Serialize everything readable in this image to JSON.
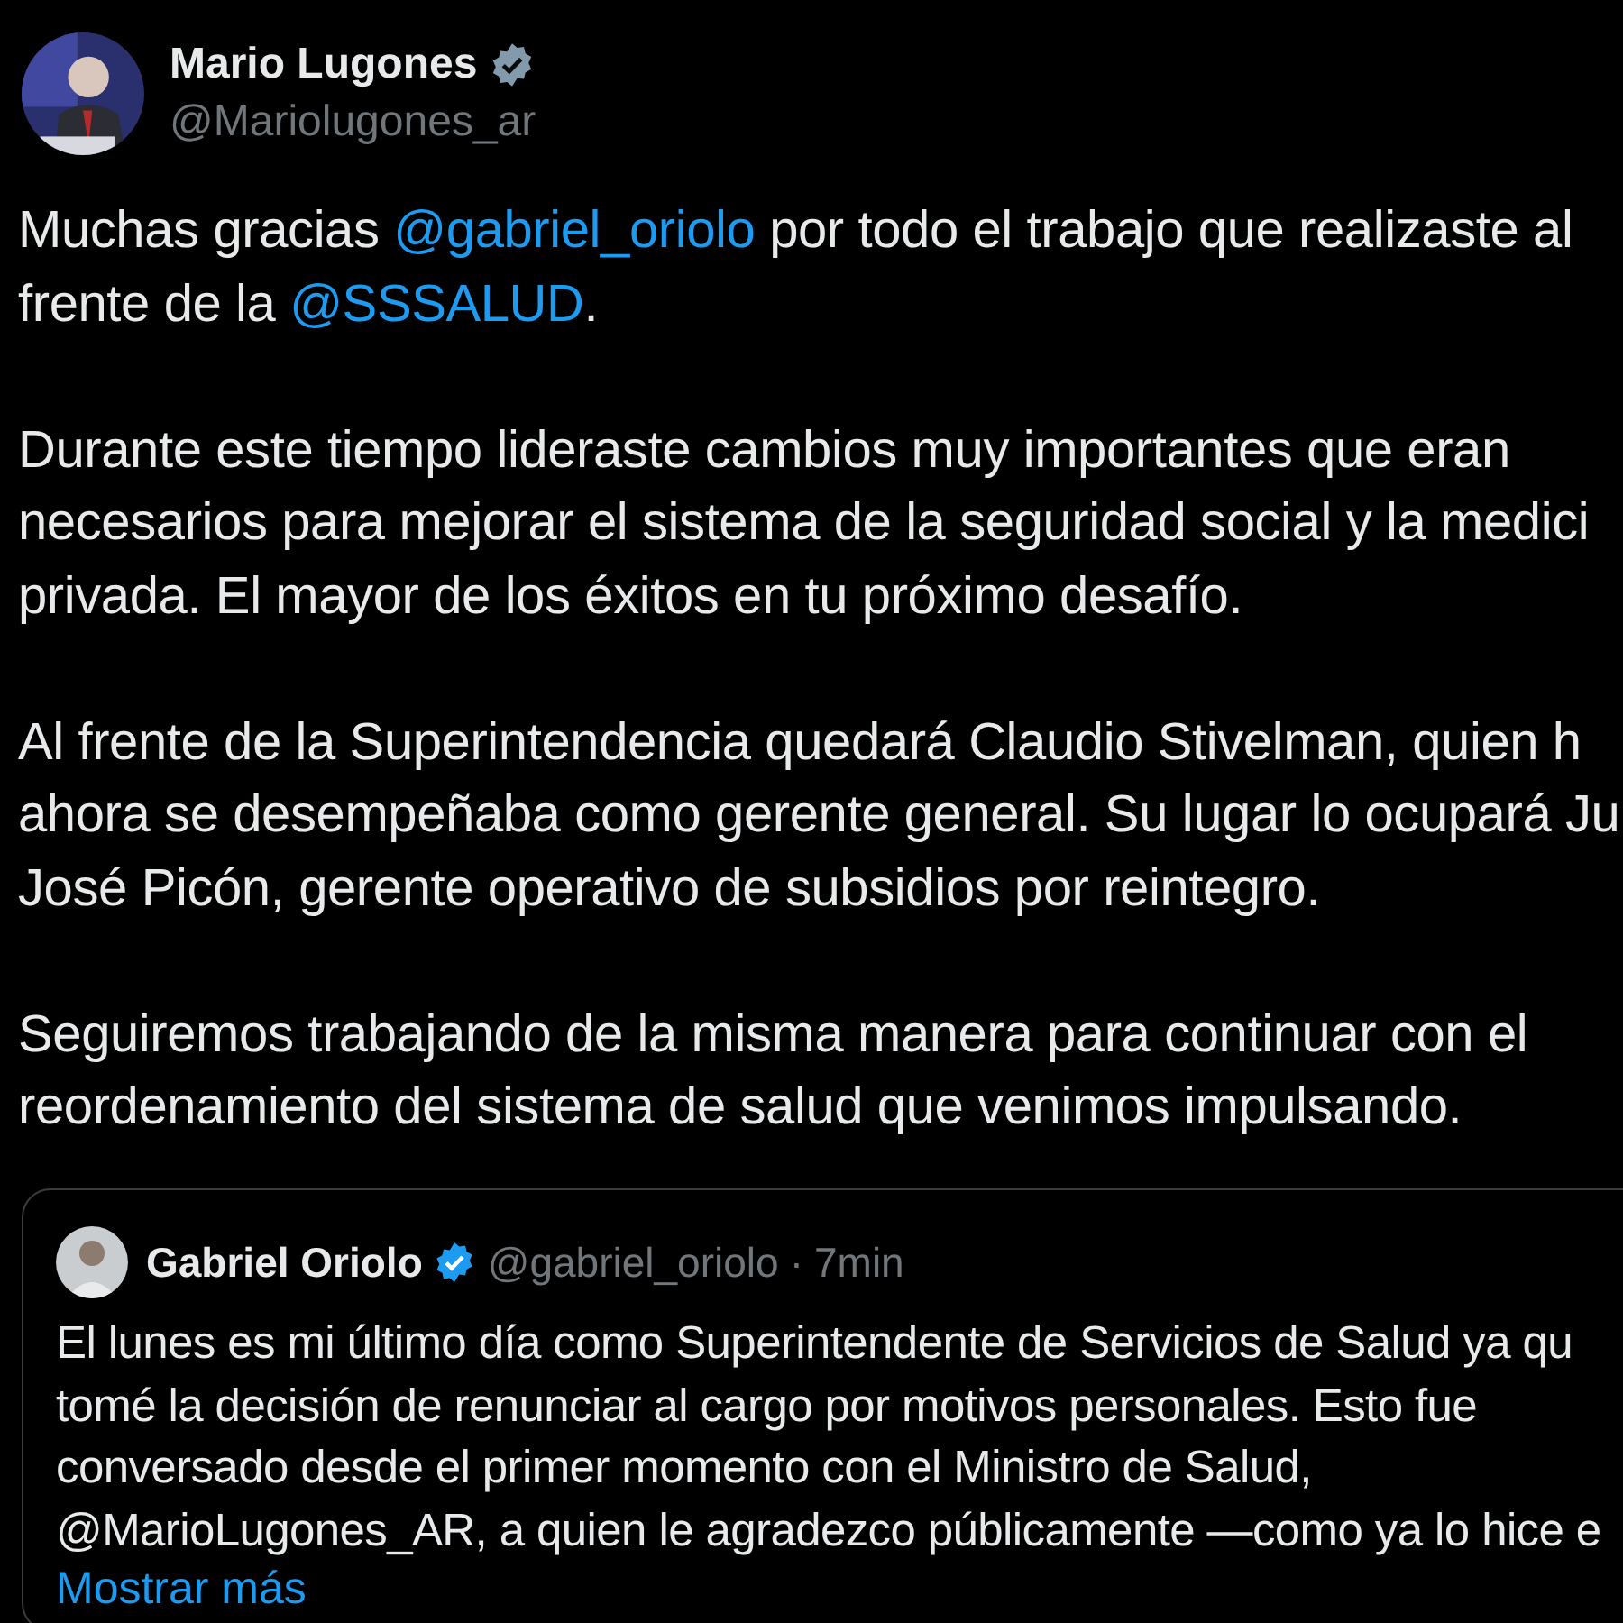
{
  "author": {
    "name": "Mario Lugones",
    "handle": "@Mariolugones_ar",
    "verified": {
      "color": "#829aab"
    }
  },
  "paragraphs": [
    [
      [
        {
          "text": "Muchas gracias "
        },
        {
          "text": "@gabriel_oriolo",
          "kind": "mention"
        },
        {
          "text": " por todo el trabajo que realizaste al"
        }
      ],
      [
        {
          "text": "frente de la "
        },
        {
          "text": "@SSSALUD",
          "kind": "mention"
        },
        {
          "text": "."
        }
      ]
    ],
    [
      [
        {
          "text": "Durante este tiempo lideraste cambios muy importantes que eran"
        }
      ],
      [
        {
          "text": "necesarios para mejorar el sistema de la seguridad social y la medici"
        }
      ],
      [
        {
          "text": "privada. El mayor de los éxitos en tu próximo desafío."
        }
      ]
    ],
    [
      [
        {
          "text": "Al frente de la Superintendencia quedará Claudio Stivelman, quien h"
        }
      ],
      [
        {
          "text": "ahora se desempeñaba como gerente general. Su lugar lo ocupará Ju"
        }
      ],
      [
        {
          "text": "José Picón, gerente operativo de subsidios por reintegro."
        }
      ]
    ],
    [
      [
        {
          "text": "Seguiremos trabajando de la misma manera para continuar con el"
        }
      ],
      [
        {
          "text": "reordenamiento del sistema de salud que venimos impulsando."
        }
      ]
    ]
  ],
  "quoted": {
    "name": "Gabriel Oriolo",
    "handle": "@gabriel_oriolo",
    "separator": "·",
    "time": "7min",
    "verified": {
      "color": "#1d9bf0"
    },
    "lines": [
      "El lunes es mi último día como Superintendente de Servicios de Salud ya qu",
      "tomé la decisión de renunciar al cargo por motivos personales. Esto fue",
      "conversado desde el primer momento con el Ministro de Salud,",
      "@MarioLugones_AR, a quien le agradezco públicamente —como ya lo hice e"
    ],
    "show_more": "Mostrar más"
  }
}
